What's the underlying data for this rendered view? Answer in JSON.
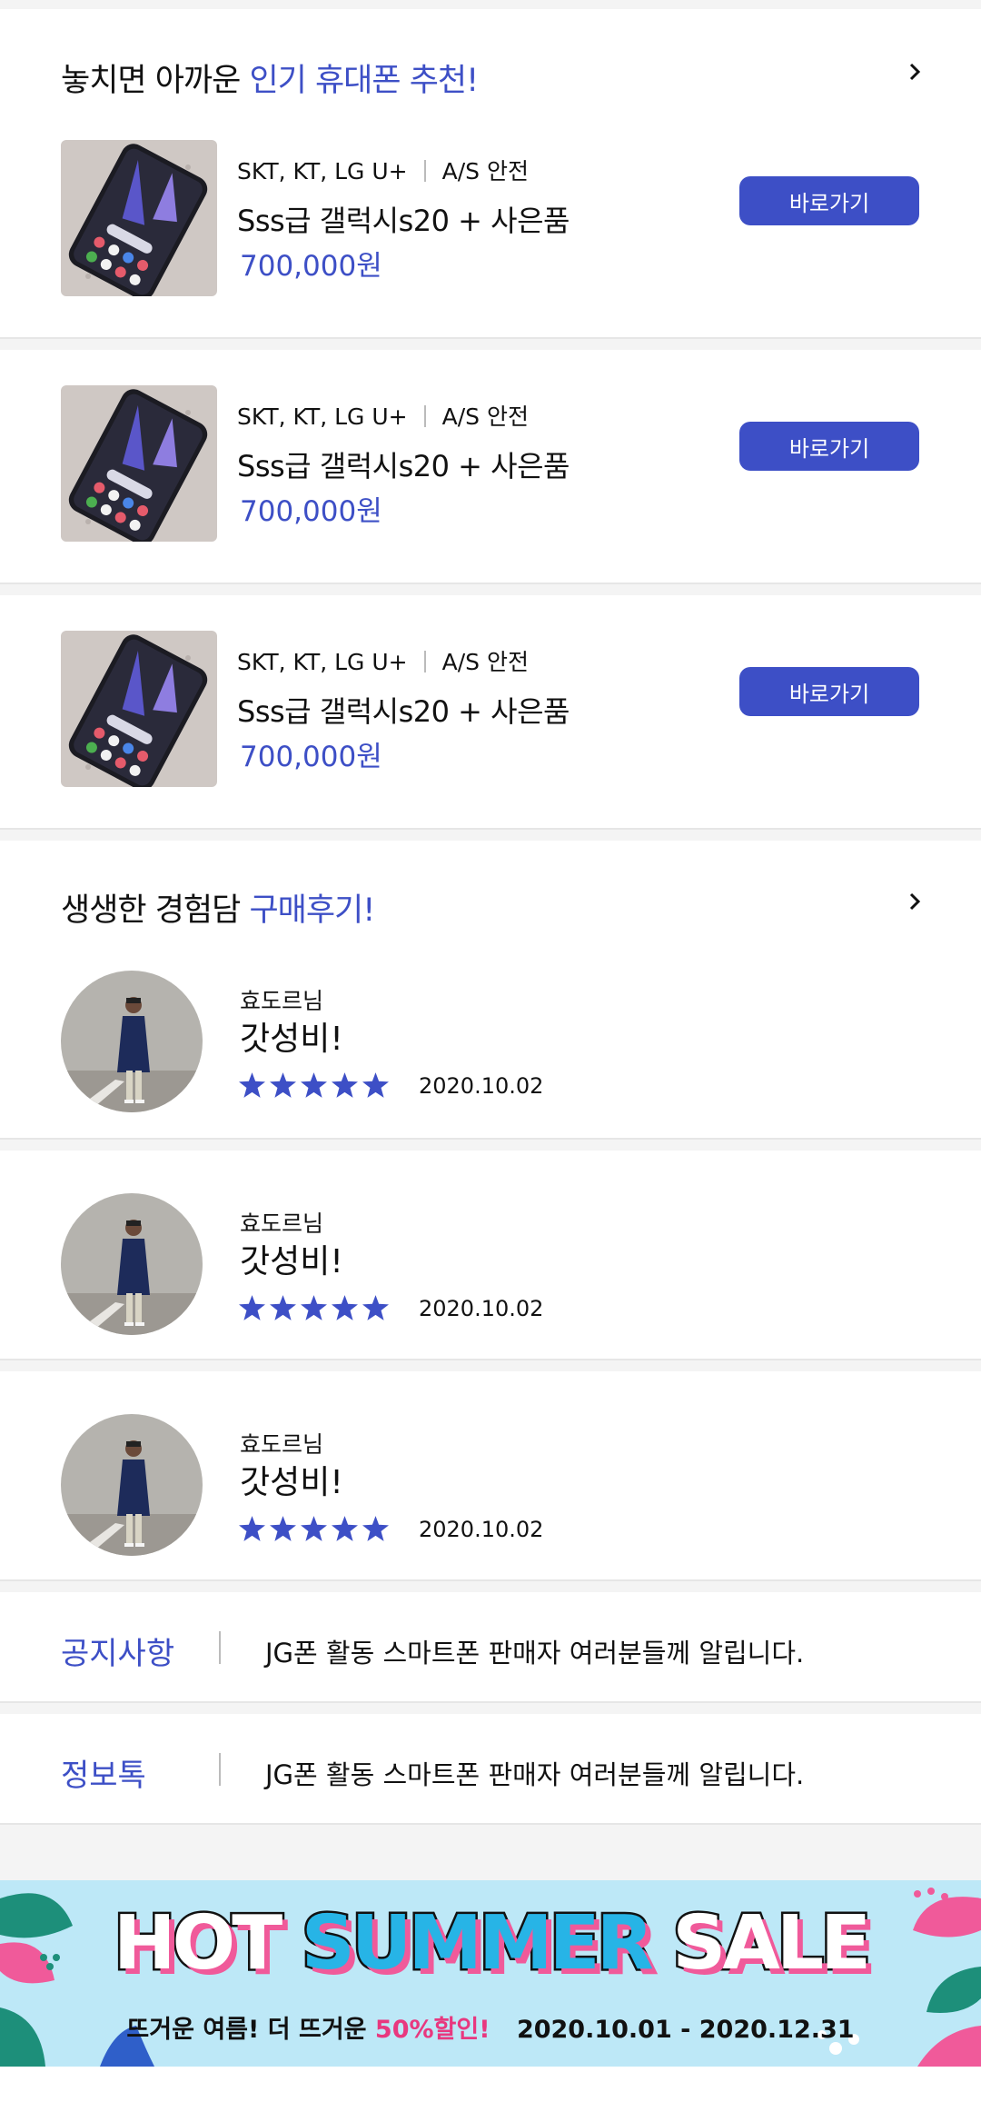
{
  "recommend": {
    "title_plain": "놓치면 아까운 ",
    "title_accent": "인기 휴대폰 추천!",
    "products": [
      {
        "carrier": "SKT, KT, LG U+",
        "as": "A/S 안전",
        "name": "Sss급 갤럭시s20 + 사은품",
        "price": "700,000원",
        "button": "바로가기"
      },
      {
        "carrier": "SKT, KT, LG U+",
        "as": "A/S 안전",
        "name": "Sss급 갤럭시s20 + 사은품",
        "price": "700,000원",
        "button": "바로가기"
      },
      {
        "carrier": "SKT, KT, LG U+",
        "as": "A/S 안전",
        "name": "Sss급 갤럭시s20 + 사은품",
        "price": "700,000원",
        "button": "바로가기"
      }
    ]
  },
  "reviews": {
    "title_plain": "생생한 경험담 ",
    "title_accent": "구매후기!",
    "items": [
      {
        "user": "효도르님",
        "title": "갓성비!",
        "rating": 5,
        "date": "2020.10.02"
      },
      {
        "user": "효도르님",
        "title": "갓성비!",
        "rating": 5,
        "date": "2020.10.02"
      },
      {
        "user": "효도르님",
        "title": "갓성비!",
        "rating": 5,
        "date": "2020.10.02"
      }
    ]
  },
  "notices": [
    {
      "label": "공지사항",
      "text": "JG폰 활동 스마트폰 판매자 여러분들께 알립니다."
    },
    {
      "label": "정보톡",
      "text": "JG폰 활동 스마트폰 판매자 여러분들께 알립니다."
    }
  ],
  "banner": {
    "word1": "HOT",
    "word2": "SUMMER",
    "word3": "SALE",
    "sub_plain1": "뜨거운 여름! 더 뜨거운 ",
    "sub_accent": "50%할인!",
    "dates": "2020.10.01 - 2020.12.31"
  },
  "colors": {
    "accent": "#3d4fc6",
    "star": "#3d4fc6",
    "banner_bg": "#bde8f7"
  },
  "icons": {
    "chevron": "chevron-right-icon",
    "star": "star-icon"
  }
}
